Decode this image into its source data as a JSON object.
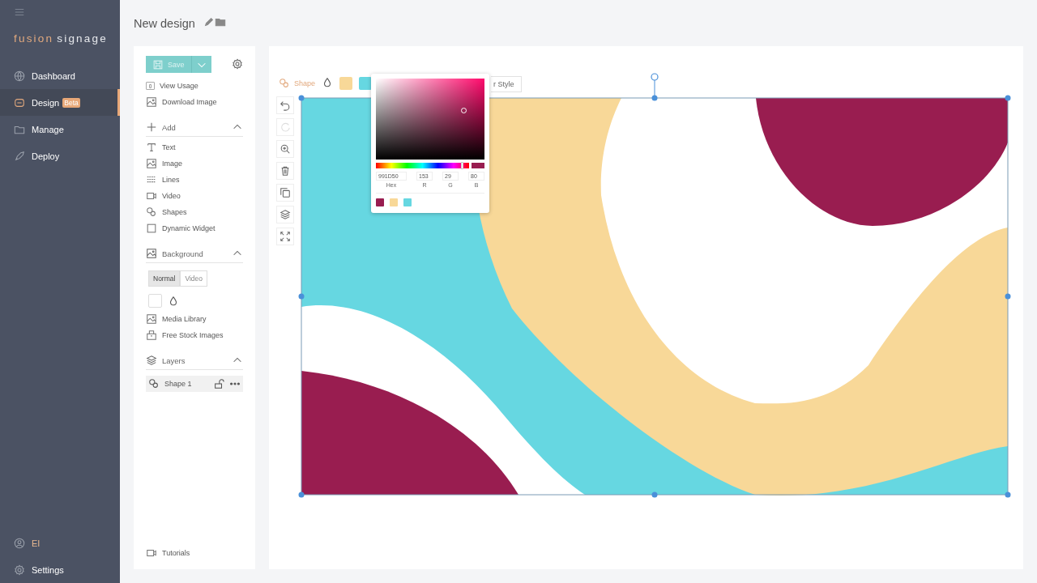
{
  "sidebar": {
    "logo_first": "fusion",
    "logo_second": "signage",
    "items": [
      {
        "label": "Dashboard",
        "selected": false
      },
      {
        "label": "Design",
        "badge": "Beta",
        "selected": true
      },
      {
        "label": "Manage",
        "selected": false
      },
      {
        "label": "Deploy",
        "selected": false
      }
    ],
    "user": "EI",
    "settings": "Settings"
  },
  "header": {
    "title": "New design"
  },
  "panel": {
    "save": "Save",
    "usage_count": "0",
    "view_usage": "View Usage",
    "download": "Download Image",
    "add": {
      "title": "Add",
      "expanded": true,
      "items": [
        "Text",
        "Image",
        "Lines",
        "Video",
        "Shapes",
        "Dynamic Widget"
      ]
    },
    "background": {
      "title": "Background",
      "expanded": true,
      "modes": [
        {
          "label": "Normal",
          "selected": true
        },
        {
          "label": "Video",
          "selected": false
        }
      ],
      "color": "#ffffff",
      "links": [
        "Media Library",
        "Free Stock Images"
      ]
    },
    "layers": {
      "title": "Layers",
      "expanded": true,
      "items": [
        {
          "label": "Shape 1",
          "selected": true
        }
      ]
    },
    "tutorials": "Tutorials"
  },
  "toolbar": {
    "shape": "Shape",
    "swatches": [
      {
        "color": "#f8d898"
      },
      {
        "color": "#66d7e1"
      }
    ],
    "style_button": "r Style"
  },
  "tools": [
    {
      "disabled": false
    },
    {
      "disabled": true
    },
    {
      "disabled": false
    },
    {
      "disabled": false
    },
    {
      "disabled": false
    },
    {
      "disabled": false
    },
    {
      "disabled": false
    }
  ],
  "color_picker": {
    "hex": "991D50",
    "r": "153",
    "g": "29",
    "b": "80",
    "hex_label": "Hex",
    "r_label": "R",
    "g_label": "G",
    "b_label": "B",
    "hue": {
      "level": 0.93
    },
    "swatches": [
      {
        "color": "#991d50"
      },
      {
        "color": "#f8d898"
      },
      {
        "color": "#66d7e1"
      }
    ]
  }
}
